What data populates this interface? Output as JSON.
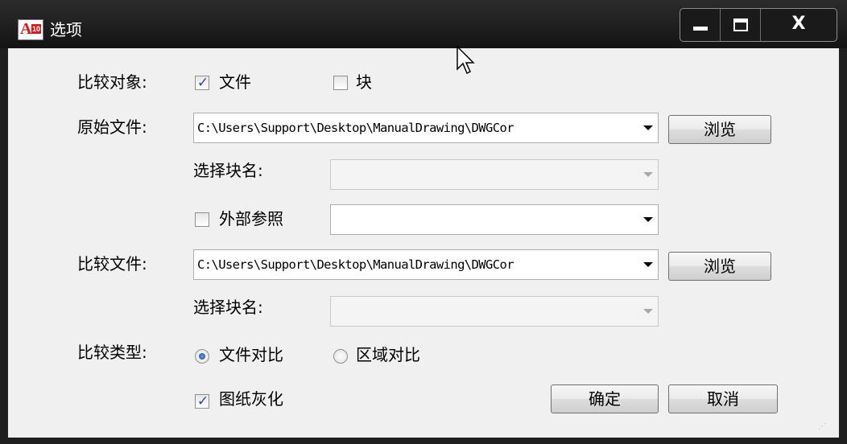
{
  "window": {
    "title": "选项",
    "icon": "autocad-a10-icon",
    "controls": {
      "minimize": "minimize-icon",
      "maximize": "maximize-icon",
      "close_glyph": "X"
    }
  },
  "compare_object": {
    "label": "比较对象:",
    "options": [
      {
        "label": "文件",
        "checked": true
      },
      {
        "label": "块",
        "checked": false
      }
    ]
  },
  "original_file": {
    "label": "原始文件:",
    "path": "C:\\Users\\Support\\Desktop\\ManualDrawing\\DWGCor",
    "browse_label": "浏览",
    "select_block_label": "选择块名:",
    "select_block_value": "",
    "xref_label": "外部参照",
    "xref_checked": false,
    "xref_value": ""
  },
  "compare_file": {
    "label": "比较文件:",
    "path": "C:\\Users\\Support\\Desktop\\ManualDrawing\\DWGCor",
    "browse_label": "浏览",
    "select_block_label": "选择块名:",
    "select_block_value": ""
  },
  "compare_type": {
    "label": "比较类型:",
    "options": [
      {
        "label": "文件对比",
        "selected": true
      },
      {
        "label": "区域对比",
        "selected": false
      }
    ]
  },
  "gray_out": {
    "label": "图纸灰化",
    "checked": true
  },
  "buttons": {
    "ok": "确定",
    "cancel": "取消"
  },
  "colors": {
    "title_bar": "#1f1f1f",
    "client_bg": "#f0f0f0",
    "check_mark": "#2a4a9a"
  }
}
